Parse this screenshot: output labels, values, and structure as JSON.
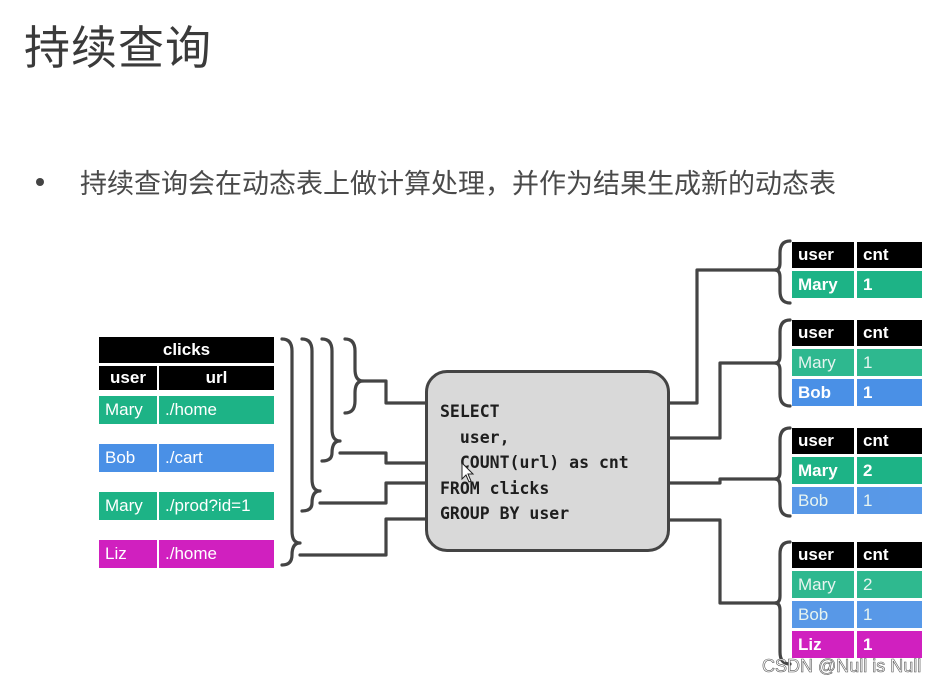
{
  "slide": {
    "title": "持续查询",
    "bullet": "持续查询会在动态表上做计算处理，并作为结果生成新的动态表"
  },
  "colors": {
    "mary": "#1db386",
    "bob": "#4a90e6",
    "liz": "#d020bf",
    "header": "#000000",
    "sql_box": "#d9d9d9",
    "wire": "#444444"
  },
  "input_table": {
    "name": "clicks",
    "columns": [
      "user",
      "url"
    ],
    "rows": [
      {
        "user": "Mary",
        "url": "./home",
        "color": "mary"
      },
      {
        "user": "Bob",
        "url": "./cart",
        "color": "bob"
      },
      {
        "user": "Mary",
        "url": "./prod?id=1",
        "color": "mary"
      },
      {
        "user": "Liz",
        "url": "./home",
        "color": "liz"
      }
    ]
  },
  "query": {
    "lines": [
      "SELECT",
      "  user,",
      "  COUNT(url) as cnt",
      "FROM clicks",
      "GROUP BY user"
    ]
  },
  "result_tables": [
    {
      "columns": [
        "user",
        "cnt"
      ],
      "rows": [
        {
          "user": "Mary",
          "cnt": "1",
          "color": "mary",
          "updated": true
        }
      ]
    },
    {
      "columns": [
        "user",
        "cnt"
      ],
      "rows": [
        {
          "user": "Mary",
          "cnt": "1",
          "color": "mary",
          "updated": false
        },
        {
          "user": "Bob",
          "cnt": "1",
          "color": "bob",
          "updated": true
        }
      ]
    },
    {
      "columns": [
        "user",
        "cnt"
      ],
      "rows": [
        {
          "user": "Mary",
          "cnt": "2",
          "color": "mary",
          "updated": true
        },
        {
          "user": "Bob",
          "cnt": "1",
          "color": "bob",
          "updated": false
        }
      ]
    },
    {
      "columns": [
        "user",
        "cnt"
      ],
      "rows": [
        {
          "user": "Mary",
          "cnt": "2",
          "color": "mary",
          "updated": false
        },
        {
          "user": "Bob",
          "cnt": "1",
          "color": "bob",
          "updated": false
        },
        {
          "user": "Liz",
          "cnt": "1",
          "color": "liz",
          "updated": true
        }
      ]
    }
  ],
  "watermark": "CSDN @Null is Null"
}
